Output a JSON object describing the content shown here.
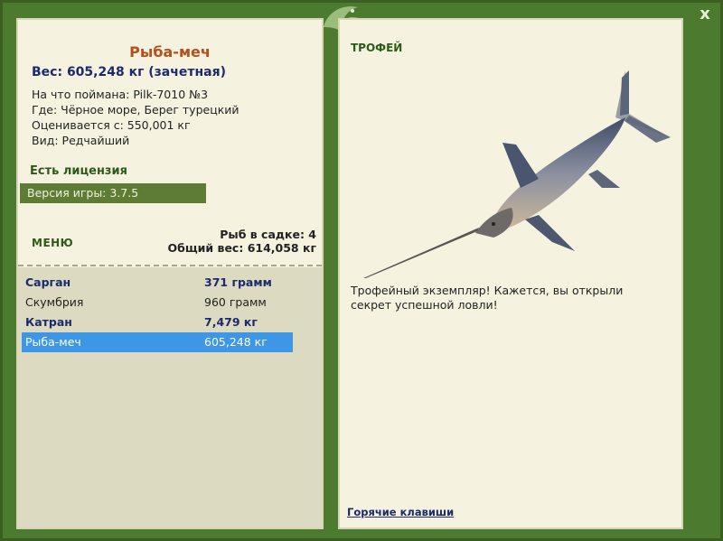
{
  "window": {
    "close_label": "x"
  },
  "fish": {
    "title": "Рыба-меч",
    "weight_line": "Вес: 605,248 кг (зачетная)",
    "info": [
      "На что поймана: Pilk-7010 №3",
      "Где: Чёрное море, Берег турецкий",
      "Оценивается с: 550,001 кг",
      "Вид: Редчайший"
    ]
  },
  "license": "Есть лицензия",
  "version": "Версия игры: 3.7.5",
  "menu_label": "МЕНЮ",
  "cage": {
    "count": "Рыб в садке: 4",
    "total": "Общий вес: 614,058 кг"
  },
  "catch": [
    {
      "name": "Сарган",
      "weight": "371 грамм",
      "style": "bold"
    },
    {
      "name": "Скумбрия",
      "weight": "960 грамм",
      "style": "normal"
    },
    {
      "name": "Катран",
      "weight": "7,479 кг",
      "style": "bold"
    },
    {
      "name": "Рыба-меч",
      "weight": "605,248 кг",
      "style": "selected"
    }
  ],
  "trophy_label": "ТРОФЕЙ",
  "description": "Трофейный экземпляр! Кажется, вы открыли секрет успешной ловли!",
  "hotkeys": "Горячие клавиши",
  "colors": {
    "frame": "#4c7a2f",
    "panel": "#f5f3e0",
    "selected": "#3d96e6",
    "title": "#b5501c"
  }
}
